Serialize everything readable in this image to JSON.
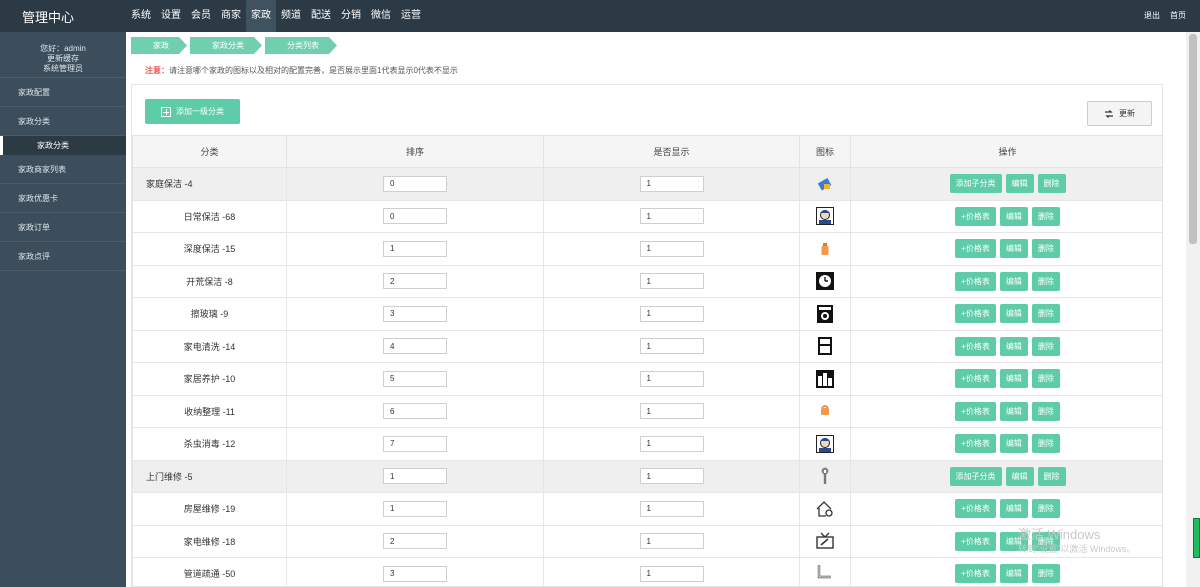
{
  "topbar": {
    "brand": "管理中心",
    "nav": [
      "系统",
      "设置",
      "会员",
      "商家",
      "家政",
      "频道",
      "配送",
      "分销",
      "微信",
      "运营"
    ],
    "active_nav": "家政",
    "logout": "退出",
    "home": "首页"
  },
  "sidebar": {
    "user_line1": "您好：admin",
    "user_line2": "更新缓存",
    "user_line3": "系统管理员",
    "items": [
      "家政配置",
      "家政分类",
      "家政分类",
      "家政商家列表",
      "家政优惠卡",
      "家政订单",
      "家政点评"
    ]
  },
  "breadcrumb": [
    "家政",
    "家政分类",
    "分类列表"
  ],
  "notice": {
    "label": "注意：",
    "text": "请注意哪个家政的图标以及相对的配置完善，是否展示里面1代表显示0代表不显示"
  },
  "buttons": {
    "add_top": "添加一级分类",
    "refresh": "更新",
    "add_child": "添加子分类",
    "price": "+价格表",
    "edit": "编辑",
    "delete": "删除"
  },
  "table": {
    "headers": [
      "分类",
      "排序",
      "是否显示",
      "图标",
      "操作"
    ],
    "rows": [
      {
        "name": "家庭保洁 -4",
        "sort": "0",
        "show": "1",
        "parent": true,
        "icon": "cleaning-icon"
      },
      {
        "name": "日常保洁 -68",
        "sort": "0",
        "show": "1",
        "parent": false,
        "icon": "worker-icon"
      },
      {
        "name": "深度保洁 -15",
        "sort": "1",
        "show": "1",
        "parent": false,
        "icon": "bottle-icon"
      },
      {
        "name": "开荒保洁 -8",
        "sort": "2",
        "show": "1",
        "parent": false,
        "icon": "clock-icon"
      },
      {
        "name": "擦玻璃 -9",
        "sort": "3",
        "show": "1",
        "parent": false,
        "icon": "washer-icon"
      },
      {
        "name": "家电清洗 -14",
        "sort": "4",
        "show": "1",
        "parent": false,
        "icon": "fridge-icon"
      },
      {
        "name": "家居养护 -10",
        "sort": "5",
        "show": "1",
        "parent": false,
        "icon": "cabinet-icon"
      },
      {
        "name": "收纳整理 -11",
        "sort": "6",
        "show": "1",
        "parent": false,
        "icon": "bag-icon"
      },
      {
        "name": "杀虫消毒 -12",
        "sort": "7",
        "show": "1",
        "parent": false,
        "icon": "worker-icon"
      },
      {
        "name": "上门维修 -5",
        "sort": "1",
        "show": "1",
        "parent": true,
        "icon": "wrench-icon"
      },
      {
        "name": "房屋维修 -19",
        "sort": "1",
        "show": "1",
        "parent": false,
        "icon": "house-gear-icon"
      },
      {
        "name": "家电维修 -18",
        "sort": "2",
        "show": "1",
        "parent": false,
        "icon": "tv-repair-icon"
      },
      {
        "name": "管道疏通 -50",
        "sort": "3",
        "show": "1",
        "parent": false,
        "icon": "pipe-icon"
      }
    ]
  },
  "watermark": {
    "line1": "激活 Windows",
    "line2": "转到\"设置\"以激活 Windows。"
  },
  "colors": {
    "topbar": "#2b3a45",
    "sidebar": "#3c4e5c",
    "accent": "#5ecca8",
    "notice": "#e35b5b"
  }
}
